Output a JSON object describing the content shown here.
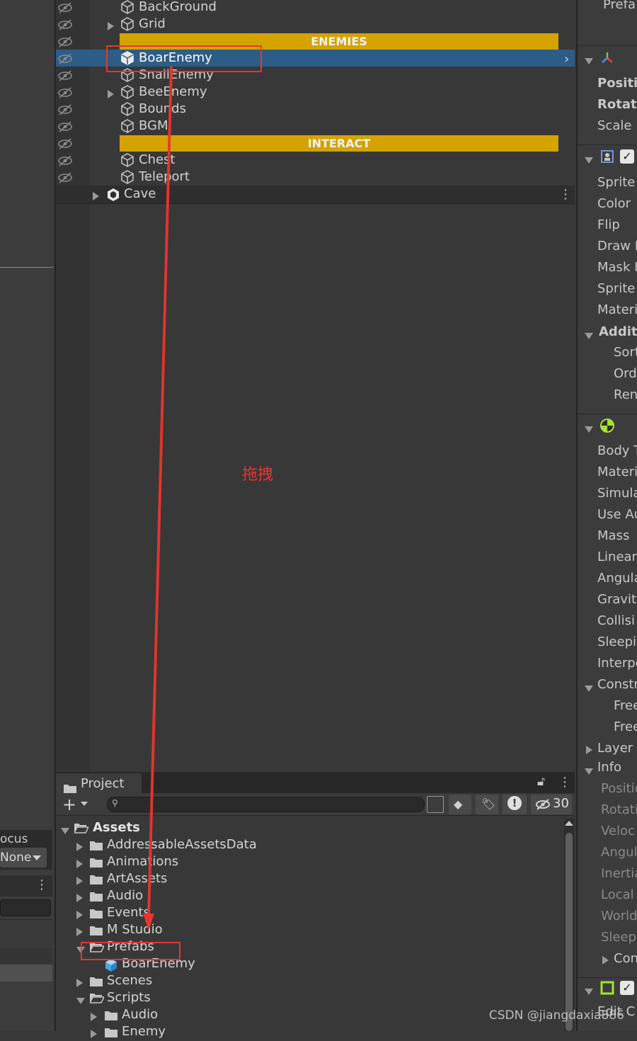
{
  "hierarchy": {
    "items": [
      {
        "label": "BackGround",
        "has_arrow": false
      },
      {
        "label": "Grid",
        "has_arrow": true
      },
      {
        "label": "BoarEnemy",
        "selected": true
      },
      {
        "label": "SnailEnemy"
      },
      {
        "label": "BeeEnemy",
        "has_arrow": true
      },
      {
        "label": "Bounds"
      },
      {
        "label": "BGM"
      },
      {
        "label": "Chest"
      },
      {
        "label": "Teleport"
      }
    ],
    "headers": {
      "enemies": "ENEMIES",
      "interact": "INTERACT"
    },
    "scene_root": "Cave"
  },
  "inspector": {
    "top_label": "Prefa",
    "transform": [
      "Positic",
      "Rotati",
      "Scale"
    ],
    "sprite_renderer": [
      "Sprite",
      "Color",
      "Flip",
      "Draw M",
      "Mask I",
      "Sprite",
      "Materi"
    ],
    "additional": "Additi",
    "additional_items": [
      "Sort",
      "Orde",
      "Ren"
    ],
    "rigidbody": [
      "Body T",
      "Materi",
      "Simula",
      "Use Au",
      "Mass",
      "Linear",
      "Angula",
      "Gravity",
      "Collisi",
      "Sleepi",
      "Interpo"
    ],
    "constraints": "Constr",
    "constraint_items": [
      "Free",
      "Free"
    ],
    "layer": "Layer",
    "info": "Info",
    "info_items": [
      "Positic",
      "Rotatic",
      "Veloc",
      "Angul",
      "Inertia",
      "Local",
      "World",
      "Sleep"
    ],
    "info_last": "Con",
    "edit_label": "Edit C"
  },
  "left_panel": {
    "focus_label": "ocus",
    "dropdown_value": "None"
  },
  "project": {
    "tab_label": "Project",
    "hidden_count": "30",
    "root": "Assets",
    "folders": [
      "AddressableAssetsData",
      "Animations",
      "ArtAssets",
      "Audio",
      "Events",
      "M Studio",
      "Prefabs"
    ],
    "prefab_child": "BoarEnemy",
    "after": [
      "Scenes",
      "Scripts"
    ],
    "scripts_children": [
      "Audio",
      "Enemy"
    ]
  },
  "annotation": {
    "drag_label": "拖拽"
  },
  "watermark": "CSDN @jiangdaxia886",
  "colors": {
    "selection": "#2c5d87",
    "header": "#d4a300",
    "annotation": "#e8352e"
  }
}
